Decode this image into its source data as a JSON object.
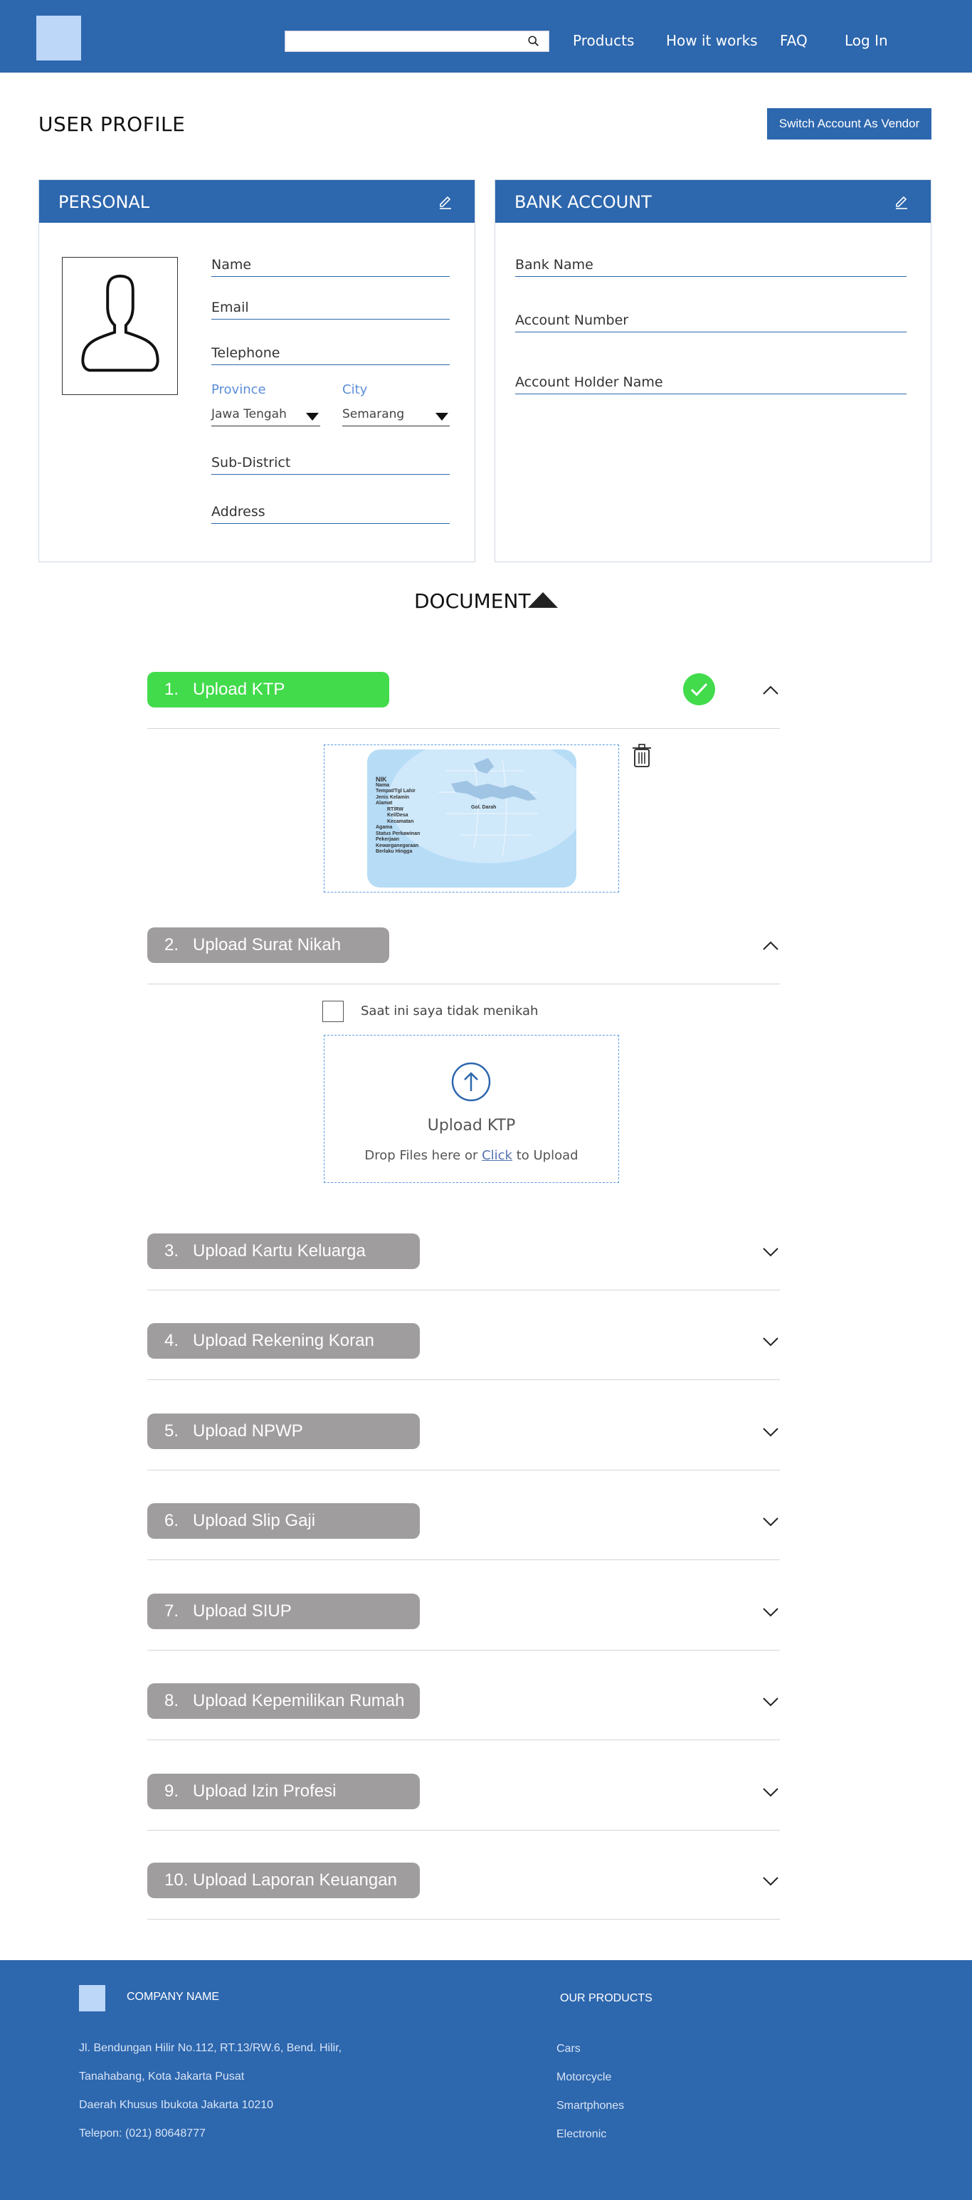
{
  "header": {
    "search_placeholder": "",
    "nav": [
      "Products",
      "How it works",
      "FAQ",
      "Log In"
    ]
  },
  "page": {
    "title": "USER PROFILE",
    "vendor_button": "Switch Account As Vendor"
  },
  "personal": {
    "title": "PERSONAL",
    "fields": {
      "name": "Name",
      "email": "Email",
      "telephone": "Telephone",
      "province_label": "Province",
      "province_value": "Jawa Tengah",
      "city_label": "City",
      "city_value": "Semarang",
      "subdistrict": "Sub-District",
      "address": "Address"
    }
  },
  "bank": {
    "title": "BANK ACCOUNT",
    "fields": {
      "bank_name": "Bank Name",
      "account_number": "Account Number",
      "holder_name": "Account Holder Name"
    }
  },
  "document": {
    "title": "DOCUMENT",
    "items": [
      {
        "num": "1.",
        "label": "Upload KTP",
        "status": "done",
        "expanded": true
      },
      {
        "num": "2.",
        "label": "Upload Surat Nikah",
        "status": "pending",
        "expanded": true
      },
      {
        "num": "3.",
        "label": "Upload Kartu Keluarga",
        "status": "pending",
        "expanded": false
      },
      {
        "num": "4.",
        "label": "Upload Rekening Koran",
        "status": "pending",
        "expanded": false
      },
      {
        "num": "5.",
        "label": "Upload NPWP",
        "status": "pending",
        "expanded": false
      },
      {
        "num": "6.",
        "label": "Upload Slip Gaji",
        "status": "pending",
        "expanded": false
      },
      {
        "num": "7.",
        "label": "Upload SIUP",
        "status": "pending",
        "expanded": false
      },
      {
        "num": "8.",
        "label": "Upload Kepemilikan Rumah",
        "status": "pending",
        "expanded": false
      },
      {
        "num": "9.",
        "label": "Upload Izin Profesi",
        "status": "pending",
        "expanded": false
      },
      {
        "num": "10.",
        "label": "Upload Laporan Keuangan",
        "status": "pending",
        "expanded": false
      }
    ],
    "ktp_card_fields": [
      "NIK",
      "Nama",
      "Tempat/Tgl Lahir",
      "Jenis Kelamin",
      "Alamat",
      "RT/RW",
      "Kel/Desa",
      "Kecamatan",
      "Agama",
      "Status Perkawinan",
      "Pekerjaan",
      "Kewarganegaraan",
      "Berlaku Hingga"
    ],
    "ktp_card_blood": "Gol. Darah",
    "not_married_label": "Saat ini saya tidak menikah",
    "upload_title": "Upload KTP",
    "upload_hint_prefix": "Drop Files here or ",
    "upload_hint_link": "Click",
    "upload_hint_suffix": " to Upload"
  },
  "footer": {
    "company_name": "COMPANY NAME",
    "address_lines": [
      "Jl. Bendungan Hilir No.112, RT.13/RW.6, Bend. Hilir,",
      "Tanahabang, Kota Jakarta Pusat",
      "Daerah Khusus Ibukota Jakarta 10210",
      "Telepon: (021) 80648777"
    ],
    "products_title": "OUR PRODUCTS",
    "products": [
      "Cars",
      "Motorcycle",
      "Smartphones",
      "Electronic"
    ]
  },
  "colors": {
    "primary": "#2d67ae",
    "logo": "#bcd7f7",
    "success": "#42db4c",
    "pill_gray": "#a09d9e",
    "link": "#5b8ed6"
  }
}
